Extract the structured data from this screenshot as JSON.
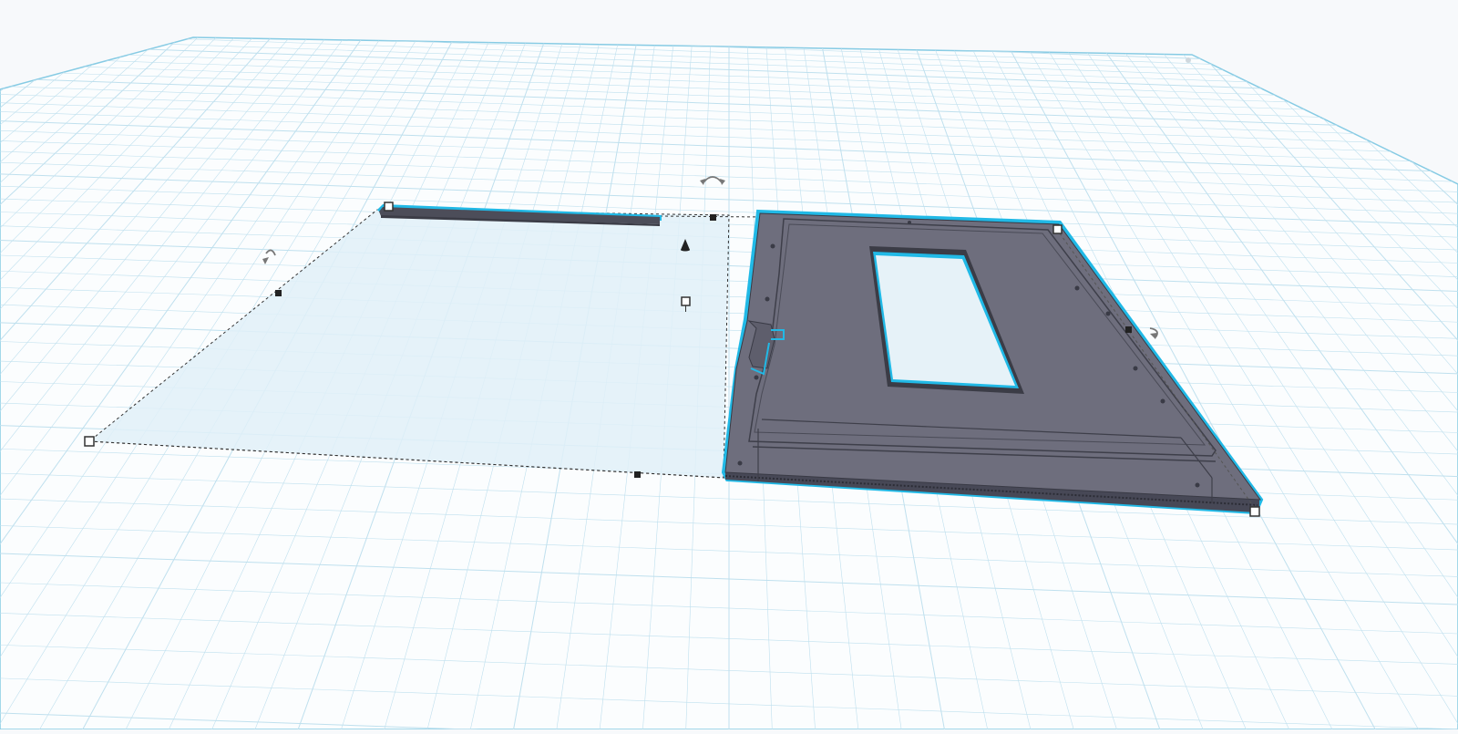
{
  "app": {
    "view": "3d-workplane"
  },
  "workplane": {
    "grid_visible": true,
    "fill_color": "#ffffff",
    "grid_color": "#bfe0ee",
    "edge_color": "#7fc8e3"
  },
  "selection": {
    "highlight_color": "#21b9e6",
    "bbox_fill": "#dff0f8",
    "handle_icons": [
      "resize-handle-icon",
      "rotate-arrow-icon",
      "lift-cone-icon"
    ]
  },
  "objects": [
    {
      "name": "thin-bar",
      "color": "#4c4d59"
    },
    {
      "name": "frame-panel",
      "color": "#6c6c7b",
      "has_cutout": true
    }
  ]
}
